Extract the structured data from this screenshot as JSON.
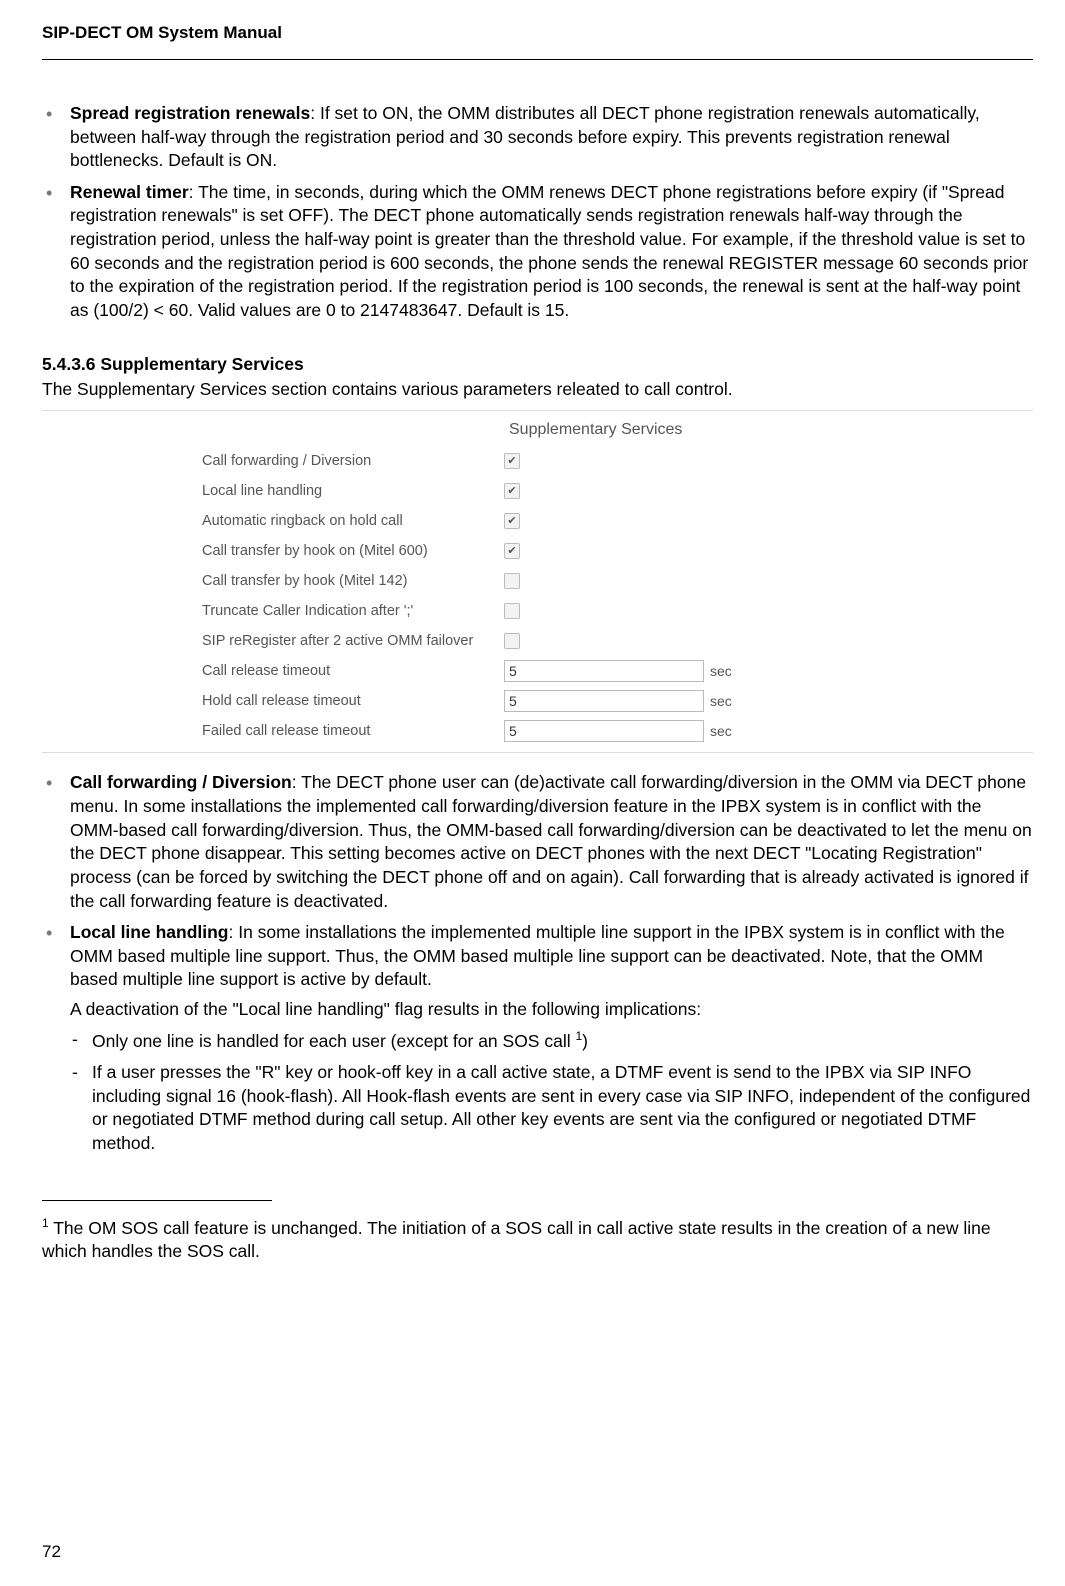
{
  "header": {
    "title": "SIP-DECT OM System Manual"
  },
  "bullets_top": [
    {
      "bold": "Spread registration renewals",
      "text": ": If set to ON, the OMM distributes all DECT phone  registration renewals automatically, between half-way through the registration period and 30 seconds before expiry. This prevents registration renewal bottlenecks. Default is ON."
    },
    {
      "bold": "Renewal timer",
      "text": ": The time, in seconds, during which the OMM renews DECT phone registrations before expiry (if \"Spread registration renewals\" is set OFF). The DECT phone automatically sends registration renewals half-way through the registration period, unless the half-way point is greater than the threshold value. For example, if the threshold value is set to 60 seconds and the registration period is 600 seconds, the phone sends the renewal REGISTER message 60 seconds prior to the expiration of the registration period. If the registration period is 100 seconds, the renewal is sent at the half-way point as (100/2) < 60. Valid values are 0 to 2147483647. Default is 15."
    }
  ],
  "section": {
    "number": "5.4.3.6 Supplementary Services",
    "intro": "The Supplementary Services section contains various parameters releated to call control."
  },
  "figure": {
    "title": "Supplementary Services",
    "rows": [
      {
        "label": "Call forwarding / Diversion",
        "type": "checkbox",
        "checked": true
      },
      {
        "label": "Local line handling",
        "type": "checkbox",
        "checked": true
      },
      {
        "label": "Automatic ringback on hold call",
        "type": "checkbox",
        "checked": true
      },
      {
        "label": "Call transfer by hook on (Mitel 600)",
        "type": "checkbox",
        "checked": true
      },
      {
        "label": "Call transfer by hook (Mitel 142)",
        "type": "checkbox",
        "checked": false
      },
      {
        "label": "Truncate Caller Indication after ';'",
        "type": "checkbox",
        "checked": false
      },
      {
        "label": "SIP reRegister after 2 active OMM failover",
        "type": "checkbox",
        "checked": false
      },
      {
        "label": "Call release timeout",
        "type": "text",
        "value": "5",
        "unit": "sec"
      },
      {
        "label": "Hold call release timeout",
        "type": "text",
        "value": "5",
        "unit": "sec"
      },
      {
        "label": "Failed call release timeout",
        "type": "text",
        "value": "5",
        "unit": "sec"
      }
    ]
  },
  "bullets_bottom": [
    {
      "bold": "Call forwarding / Diversion",
      "text": ": The DECT phone user can (de)activate call forwarding/diversion in the OMM via DECT phone menu. In some installations the implemented call forwarding/diversion feature in the IPBX system is in conflict with the OMM-based call forwarding/diversion. Thus, the OMM-based call forwarding/diversion can be deactivated to let the menu on the DECT phone disappear. This setting becomes active on DECT phones with the next DECT \"Locating Registration\" process (can be forced by switching the DECT phone off and on again). Call forwarding that is already activated is ignored if the call forwarding feature is deactivated."
    },
    {
      "bold": "Local line handling",
      "text": ": In some installations the implemented multiple line support in the IPBX system is in conflict with the OMM based multiple line support. Thus, the OMM based multiple line support can be deactivated. Note, that the OMM based multiple line support is active by default."
    }
  ],
  "local_line_extra": "A deactivation of the \"Local line handling\" flag results in the following implications:",
  "dash_items": [
    {
      "text_pre": "Only one line is handled for each user (except for an SOS call ",
      "sup": "1",
      "text_post": ")"
    },
    {
      "text_pre": "If a user presses the \"R\" key or hook-off key in a call active state, a DTMF event is send to the IPBX via SIP INFO including signal 16 (hook-flash). All Hook-flash events are sent in every case via SIP INFO, independent of the configured or negotiated DTMF method during call setup. All other key events are sent via the configured or negotiated DTMF method.",
      "sup": "",
      "text_post": ""
    }
  ],
  "footnote": {
    "num": "1",
    "text": " The OM SOS call feature is unchanged. The initiation of a SOS call in call active state results in the creation of a new line which handles the SOS call."
  },
  "page_number": "72"
}
